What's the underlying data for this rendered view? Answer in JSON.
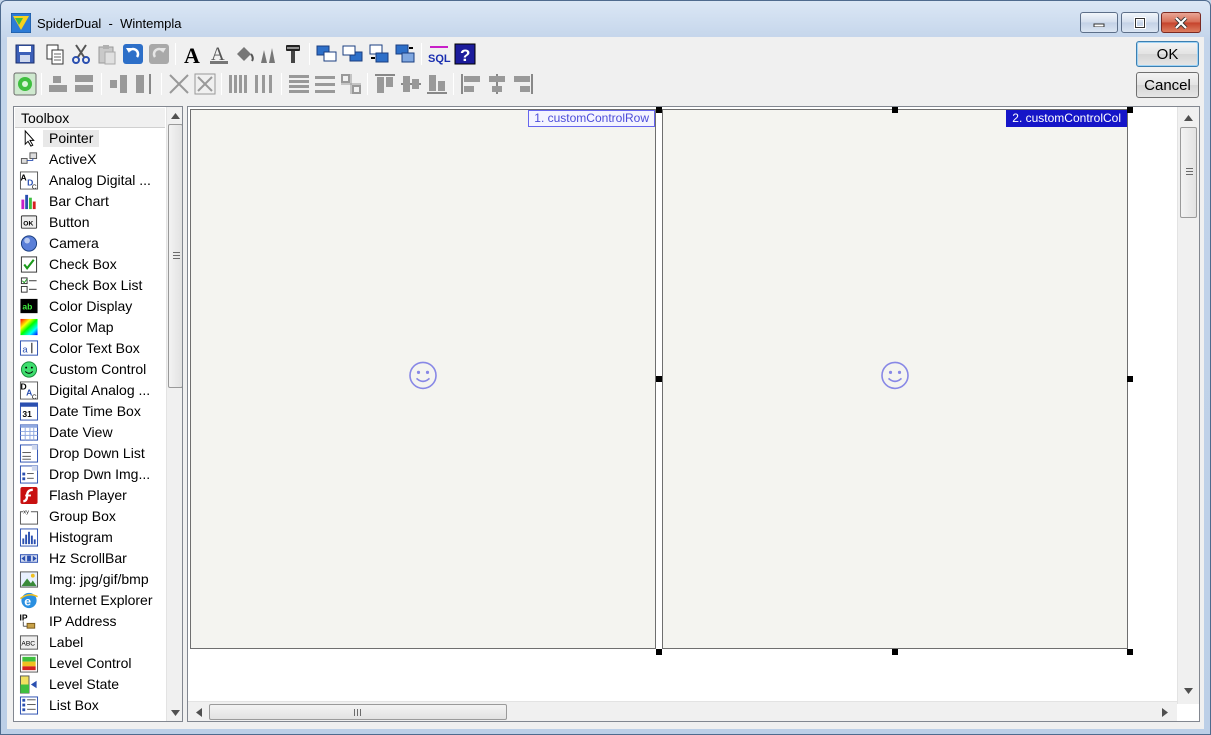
{
  "window": {
    "app_name": "SpiderDual",
    "separator": "  -  ",
    "document_name": "Wintempla"
  },
  "dialog": {
    "ok_label": "OK",
    "cancel_label": "Cancel"
  },
  "toolbar": {
    "row1": [
      "save-icon",
      "copy-icon",
      "cut-icon",
      "paste-icon",
      "undo-icon",
      "redo-icon",
      "font-icon",
      "font-color-icon",
      "fill-color-icon",
      "line-color-icon",
      "format-painter-icon",
      "bring-to-front-icon",
      "send-to-back-icon",
      "bring-forward-icon",
      "send-backward-icon",
      "sql-icon",
      "help-icon"
    ],
    "row2": [
      "event-icon",
      "same-width-icon",
      "same-height-icon",
      "center-horizontal-icon",
      "center-vertical-icon",
      "expand-icon",
      "shrink-icon",
      "space-columns-icon",
      "space-columns-evenly-icon",
      "space-rows-icon",
      "space-rows-evenly-icon",
      "grid-icon",
      "align-top-icon",
      "align-middle-icon",
      "align-bottom-icon",
      "align-left-icon",
      "align-center-icon",
      "align-right-icon"
    ]
  },
  "toolbox": {
    "title": "Toolbox",
    "items": [
      {
        "label": "Pointer",
        "icon": "pointer-icon"
      },
      {
        "label": "ActiveX",
        "icon": "activex-icon"
      },
      {
        "label": "Analog Digital ...",
        "icon": "analog-digital-icon"
      },
      {
        "label": "Bar Chart",
        "icon": "bar-chart-icon"
      },
      {
        "label": "Button",
        "icon": "button-icon"
      },
      {
        "label": "Camera",
        "icon": "camera-icon"
      },
      {
        "label": "Check Box",
        "icon": "check-box-icon"
      },
      {
        "label": "Check Box List",
        "icon": "check-box-list-icon"
      },
      {
        "label": "Color Display",
        "icon": "color-display-icon"
      },
      {
        "label": "Color Map",
        "icon": "color-map-icon"
      },
      {
        "label": "Color Text Box",
        "icon": "color-text-box-icon"
      },
      {
        "label": "Custom Control",
        "icon": "custom-control-icon"
      },
      {
        "label": "Digital Analog ...",
        "icon": "digital-analog-icon"
      },
      {
        "label": "Date Time Box",
        "icon": "date-time-box-icon"
      },
      {
        "label": "Date View",
        "icon": "date-view-icon"
      },
      {
        "label": "Drop Down List",
        "icon": "drop-down-list-icon"
      },
      {
        "label": "Drop Dwn Img...",
        "icon": "drop-down-image-icon"
      },
      {
        "label": "Flash Player",
        "icon": "flash-player-icon"
      },
      {
        "label": "Group Box",
        "icon": "group-box-icon"
      },
      {
        "label": "Histogram",
        "icon": "histogram-icon"
      },
      {
        "label": "Hz ScrollBar",
        "icon": "hz-scrollbar-icon"
      },
      {
        "label": "Img: jpg/gif/bmp",
        "icon": "image-icon"
      },
      {
        "label": "Internet Explorer",
        "icon": "internet-explorer-icon"
      },
      {
        "label": "IP Address",
        "icon": "ip-address-icon"
      },
      {
        "label": "Label",
        "icon": "label-icon"
      },
      {
        "label": "Level Control",
        "icon": "level-control-icon"
      },
      {
        "label": "Level State",
        "icon": "level-state-icon"
      },
      {
        "label": "List Box",
        "icon": "list-box-icon"
      }
    ]
  },
  "canvas": {
    "controls": [
      {
        "tag": "1. customControlRow",
        "selected": false,
        "icon": "smiley-icon"
      },
      {
        "tag": "2. customControlCol",
        "selected": true,
        "icon": "smiley-icon"
      }
    ]
  },
  "colors": {
    "selected_tag_bg": "#1515c8",
    "unselected_tag_text": "#4d4dd9",
    "panel_bg": "#f4f4f0"
  }
}
